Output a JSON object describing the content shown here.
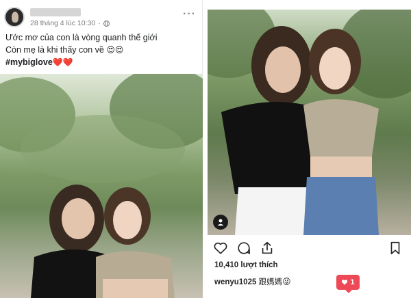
{
  "facebook": {
    "timestamp": "28 tháng 4 lúc 10:30",
    "separator": "·",
    "more": "···",
    "lines": [
      "Ước mơ của con là vòng quanh thế giới",
      "Còn mẹ là khi thấy con về"
    ],
    "line2_emoji": "😍😍",
    "hashtag": "#mybiglove",
    "hashtag_emoji": "❤️❤️"
  },
  "instagram": {
    "likes": "10,410 lượt thích",
    "caption_user": "wenyu1025",
    "caption_text": "跟媽媽",
    "caption_emoji": "😜",
    "notif_count": "1",
    "icons": [
      "heart-icon",
      "comment-icon",
      "share-icon",
      "bookmark-icon",
      "user-tag-icon"
    ]
  },
  "colors": {
    "notif_red": "#ed4956",
    "text": "#262626",
    "meta_gray": "#7a7a7a"
  }
}
